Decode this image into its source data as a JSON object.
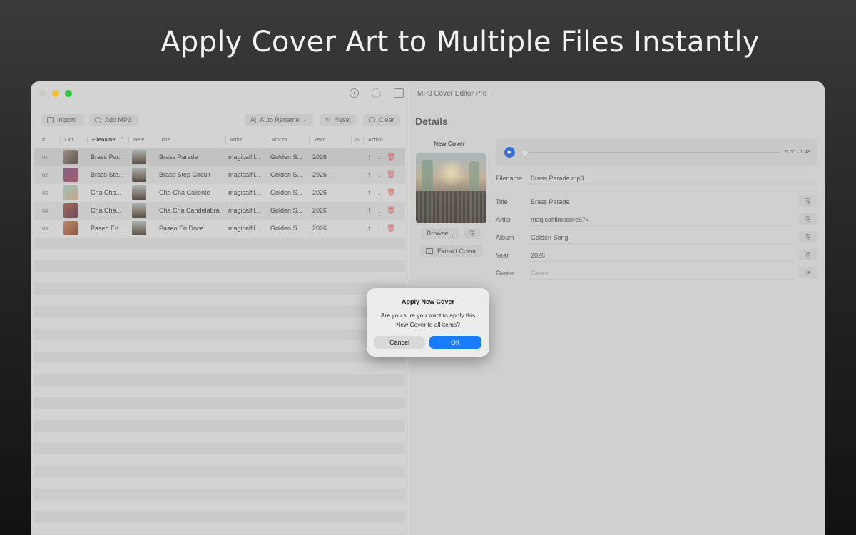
{
  "headline": "Apply Cover Art to Multiple Files Instantly",
  "window": {
    "app_title": "MP3 Cover Editor Pro",
    "toolbar": {
      "import_label": "Import",
      "add_label": "Add MP3",
      "rename_label": "Auto Rename",
      "reset_label": "Reset",
      "clear_label": "Clear"
    },
    "table": {
      "headers": {
        "num": "#",
        "old": "Old...",
        "filename": "Filename",
        "new": "New...",
        "title": "Title",
        "artist": "Artist",
        "album": "Album",
        "year": "Year",
        "genre": "G",
        "action": "Action"
      },
      "rows": [
        {
          "num": "01",
          "filename": "Brass Par...",
          "title": "Brass Parade",
          "artist": "magicalfil...",
          "album": "Golden S...",
          "year": "2026"
        },
        {
          "num": "02",
          "filename": "Brass Ste...",
          "title": "Brass Step Circuit",
          "artist": "magicalfil...",
          "album": "Golden S...",
          "year": "2026"
        },
        {
          "num": "03",
          "filename": "Cha Cha...",
          "title": "Cha-Cha Caliente",
          "artist": "magicalfil...",
          "album": "Golden S...",
          "year": "2026"
        },
        {
          "num": "04",
          "filename": "Cha Cha...",
          "title": "Cha Cha Candelabra",
          "artist": "magicalfil...",
          "album": "Golden S...",
          "year": "2026"
        },
        {
          "num": "05",
          "filename": "Paseo En...",
          "title": "Paseo En Doce",
          "artist": "magicalfil...",
          "album": "Golden S...",
          "year": "2026"
        }
      ]
    },
    "details": {
      "title": "Details",
      "new_cover_label": "New Cover",
      "browse_label": "Browse...",
      "extract_label": "Extract Cover",
      "player_time": "0:00 / 1:48",
      "player_progress": 0,
      "fields": {
        "filename_label": "Filename",
        "filename_value": "Brass Parade.mp3",
        "title_label": "Title",
        "title_value": "Brass Parade",
        "artist_label": "Artist",
        "artist_value": "magicalfilmscore674",
        "album_label": "Album",
        "album_value": "Golden Song",
        "year_label": "Year",
        "year_value": "2026",
        "genre_label": "Genre",
        "genre_placeholder": "Genre"
      }
    },
    "dialog": {
      "title": "Apply New Cover",
      "message": "Are you sure you want to apply this New Cover to all items?",
      "cancel_label": "Cancel",
      "ok_label": "OK"
    }
  },
  "colors": {
    "accent": "#1a7bff",
    "play_button": "#3a6fd8",
    "delete": "#d36b6b",
    "traffic_minimize": "#f5c02b",
    "traffic_maximize": "#33c748"
  },
  "icons": [
    "info-icon",
    "gear-icon",
    "sidebar-icon",
    "import-icon",
    "add-icon",
    "rename-icon",
    "reset-icon",
    "clear-icon",
    "arrow-up-icon",
    "arrow-down-icon",
    "trash-icon",
    "copy-icon",
    "play-icon",
    "photo-icon"
  ]
}
